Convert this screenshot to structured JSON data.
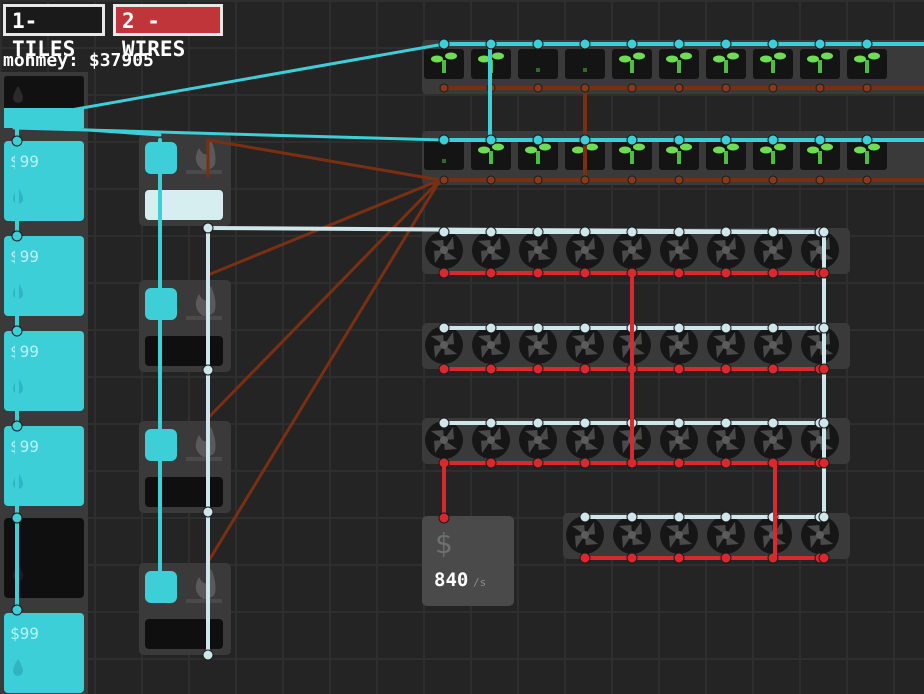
{
  "tabs": [
    {
      "key": "1",
      "label": "1-TILES"
    },
    {
      "key": "2",
      "label": "2 - WIRES"
    }
  ],
  "money": {
    "label": "monmey:",
    "value": "$37905"
  },
  "tank_column": {
    "tank_labels": [
      "$99",
      "$99",
      "$99",
      "$99",
      "$99"
    ]
  },
  "sell_point": {
    "icon": "$",
    "rate_value": "840",
    "rate_unit": "/s"
  },
  "colors": {
    "water_wire": "#3ccfd8",
    "power_wire": "#cfe6ea",
    "money_wire": "#d8292e",
    "plant_wire": "#7a2f12",
    "tab_wires_bg": "#c0353a",
    "tile_bg": "#3a3a3a"
  },
  "icons": {
    "plant": "sprout-icon",
    "fan": "fan-icon",
    "flame": "flame-icon",
    "drop": "water-drop-icon",
    "dollar": "dollar-icon"
  }
}
